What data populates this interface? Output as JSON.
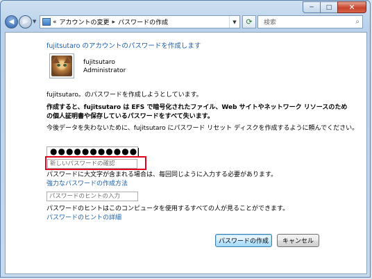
{
  "window": {
    "caption": {
      "minimize": "─",
      "maximize": "□",
      "close": "✕"
    }
  },
  "nav": {
    "back_icon": "back-arrow-icon",
    "forward_icon": "forward-arrow-icon",
    "breadcrumb_prefix": "«",
    "breadcrumb": [
      "アカウントの変更",
      "パスワードの作成"
    ],
    "breadcrumb_separator": "▸",
    "refresh_icon": "refresh-icon",
    "search_placeholder": "検索"
  },
  "main": {
    "heading": "fujitsutaro のアカウントのパスワードを作成します",
    "user": {
      "name": "fujitsutaro",
      "role": "Administrator"
    },
    "intro": "fujitsutaro。のパスワードを作成しようとしています。",
    "warning": "作成すると、fujitsutaro は EFS で暗号化されたファイル、Web サイトやネットワーク リソースのための個人証明書や保存しているパスワードをすべて失います。",
    "reset_hint": "今後データを失わないために、fujitsutaro にパスワード リセット ディスクを作成するように頼んでください。",
    "new_password_value": "●●●●●●●●●●●",
    "confirm_placeholder": "新しいパスワードの確認",
    "case_info": "パスワードに大文字が含まれる場合は、毎回同じように入力する必要があります。",
    "strong_password_link": "強力なパスワードの作成方法",
    "hint_placeholder": "パスワードのヒントの入力",
    "hint_info": "パスワードのヒントはこのコンピュータを使用するすべての人が見ることができます。",
    "hint_link": "パスワードのヒントの詳細",
    "create_button": "パスワードの作成",
    "cancel_button": "キャンセル"
  },
  "colors": {
    "link": "#1b5fab",
    "highlight": "#e0001b"
  }
}
